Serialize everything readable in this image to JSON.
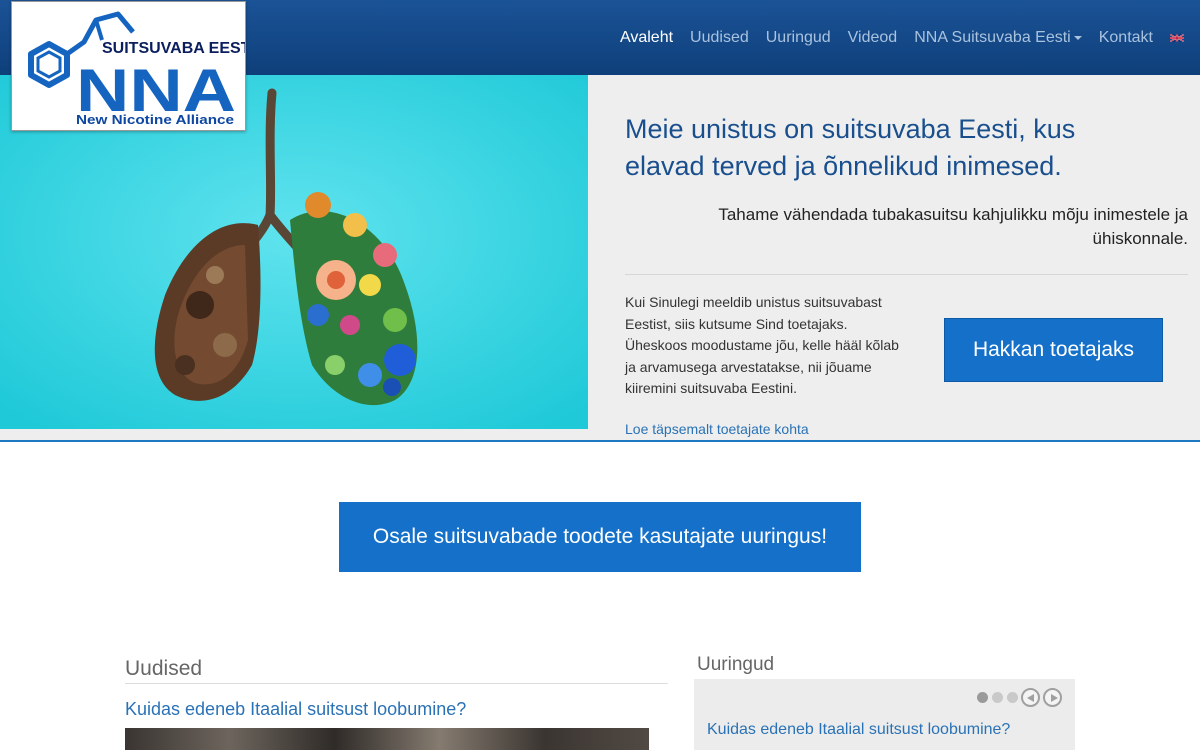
{
  "logo": {
    "top_text": "SUITSUVABA EESTI",
    "main_text": "NNA",
    "sub_text": "New Nicotine Alliance"
  },
  "nav": {
    "items": [
      "Avaleht",
      "Uudised",
      "Uuringud",
      "Videod",
      "NNA Suitsuvaba Eesti",
      "Kontakt"
    ],
    "active": "Avaleht",
    "language_icon": "uk-flag-icon"
  },
  "hero": {
    "headline": "Meie unistus on suitsuvaba Eesti, kus elavad terved ja õnnelikud inimesed.",
    "subheadline": "Tahame vähendada tubakasuitsu kahjulikku mõju inimestele ja ühiskonnale.",
    "body": "Kui Sinulegi meeldib unistus suitsuvabast Eestist, siis kutsume Sind toetajaks. Üheskoos moodustame jõu, kelle hääl kõlab ja arvamusega arvestatakse, nii jõuame kiiremini suitsuvaba Eestini.",
    "button": "Hakkan toetajaks",
    "link": "Loe täpsemalt toetajate kohta"
  },
  "cta": {
    "label": "Osale suitsuvabade toodete kasutajate uuringus!"
  },
  "news": {
    "title": "Uudised",
    "article_title": "Kuidas edeneb Itaalial suitsust loobumine?"
  },
  "studies": {
    "title": "Uuringud",
    "slider_total": 3,
    "slider_active": 1,
    "article_title": "Kuidas edeneb Itaalial suitsust loobumine?"
  },
  "colors": {
    "nav_bg": "#1b5397",
    "accent": "#1470c8",
    "link": "#2a72b5",
    "hero_bg": "#eeeeee",
    "hero_image_bg": "#2fd3df"
  }
}
